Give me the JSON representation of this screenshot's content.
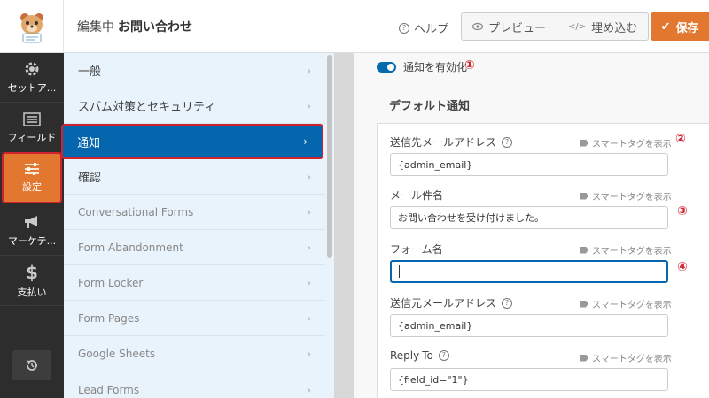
{
  "header": {
    "editing_prefix": "編集中",
    "form_title": "お問い合わせ",
    "help_label": "ヘルプ",
    "preview_label": "プレビュー",
    "embed_label": "埋め込む",
    "save_label": "保存"
  },
  "sidebar": {
    "items": [
      {
        "label": "セットア...",
        "icon": "gear-icon"
      },
      {
        "label": "フィールド",
        "icon": "list-icon"
      },
      {
        "label": "設定",
        "icon": "sliders-icon"
      },
      {
        "label": "マーケテ...",
        "icon": "megaphone-icon"
      },
      {
        "label": "支払い",
        "icon": "dollar-icon"
      }
    ],
    "active_index": 2
  },
  "settings_menu": {
    "items": [
      {
        "label": "一般"
      },
      {
        "label": "スパム対策とセキュリティ"
      },
      {
        "label": "通知"
      },
      {
        "label": "確認"
      },
      {
        "label": "Conversational Forms"
      },
      {
        "label": "Form Abandonment"
      },
      {
        "label": "Form Locker"
      },
      {
        "label": "Form Pages"
      },
      {
        "label": "Google Sheets"
      },
      {
        "label": "Lead Forms"
      }
    ],
    "active_index": 2
  },
  "notifications": {
    "toggle_label": "通知を有効化",
    "toggle_on": true,
    "section_title": "デフォルト通知",
    "smart_tag_label": "スマートタグを表示",
    "fields": [
      {
        "label": "送信先メールアドレス",
        "value": "{admin_email}",
        "has_help": true
      },
      {
        "label": "メール件名",
        "value": "お問い合わせを受け付けました。",
        "has_help": false
      },
      {
        "label": "フォーム名",
        "value": "",
        "has_help": false,
        "focused": true
      },
      {
        "label": "送信元メールアドレス",
        "value": "{admin_email}",
        "has_help": true
      },
      {
        "label": "Reply-To",
        "value": "{field_id=\"1\"}",
        "has_help": true
      }
    ]
  },
  "annotations": [
    "①",
    "②",
    "③",
    "④"
  ],
  "colors": {
    "accent_orange": "#e27730",
    "active_blue": "#0565ad",
    "highlight_red": "#d2212f",
    "sidebar_dark": "#2d2d2d",
    "menu_bg": "#e8f3fc"
  }
}
